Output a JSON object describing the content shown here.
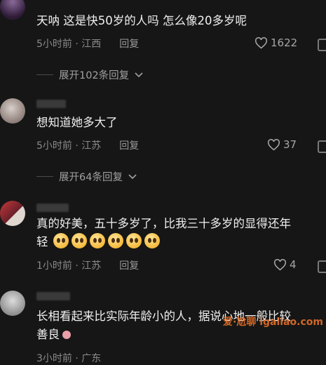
{
  "comments": [
    {
      "text": "天呐 这是快50岁的人吗 怎么像20多岁呢",
      "time": "5小时前",
      "region": "江西",
      "reply_label": "回复",
      "likes": "1622",
      "expand_label": "展开102条回复"
    },
    {
      "text": "想知道她多大了",
      "time": "5小时前",
      "region": "江苏",
      "reply_label": "回复",
      "likes": "37",
      "expand_label": "展开64条回复"
    },
    {
      "text_line1": "真的好美，五十多岁了，比我三十多岁的显得还年",
      "text_line2": "轻",
      "time": "1小时前",
      "region": "江苏",
      "reply_label": "回复",
      "likes": "4"
    },
    {
      "text_line1": "长相看起来比实际年龄小的人，据说心地一般比较",
      "text_line2": "善良",
      "time": "3小时前",
      "region": "广东"
    }
  ],
  "separator": "·",
  "watermark": "爱·尬聊 igaliao.com"
}
